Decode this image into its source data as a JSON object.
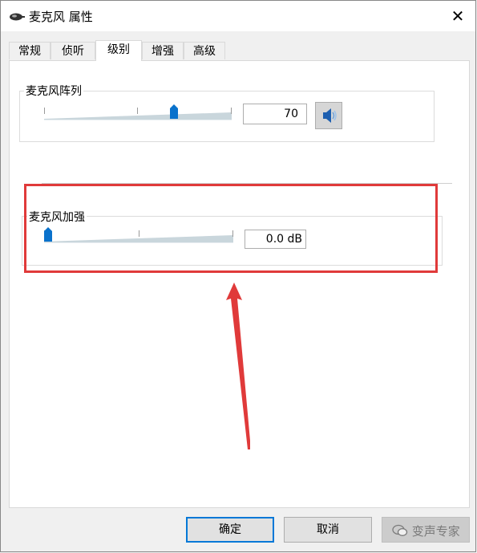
{
  "window": {
    "title": "麦克风 属性",
    "close_label": "✕"
  },
  "tabs": [
    {
      "label": "常规",
      "active": false
    },
    {
      "label": "侦听",
      "active": false
    },
    {
      "label": "级别",
      "active": true
    },
    {
      "label": "增强",
      "active": false
    },
    {
      "label": "高级",
      "active": false
    }
  ],
  "mic_array": {
    "label": "麦克风阵列",
    "value": "70",
    "slider_percent": 70,
    "speaker_icon": "speaker-icon"
  },
  "mic_boost": {
    "label": "麦克风加强",
    "value": "0.0 dB",
    "slider_percent": 0
  },
  "buttons": {
    "ok": "确定",
    "cancel": "取消"
  },
  "watermark": {
    "text": "变声专家",
    "icon": "wechat-icon"
  },
  "colors": {
    "accent": "#0078d7",
    "highlight": "#e03a3a",
    "thumb": "#0a72cc"
  }
}
